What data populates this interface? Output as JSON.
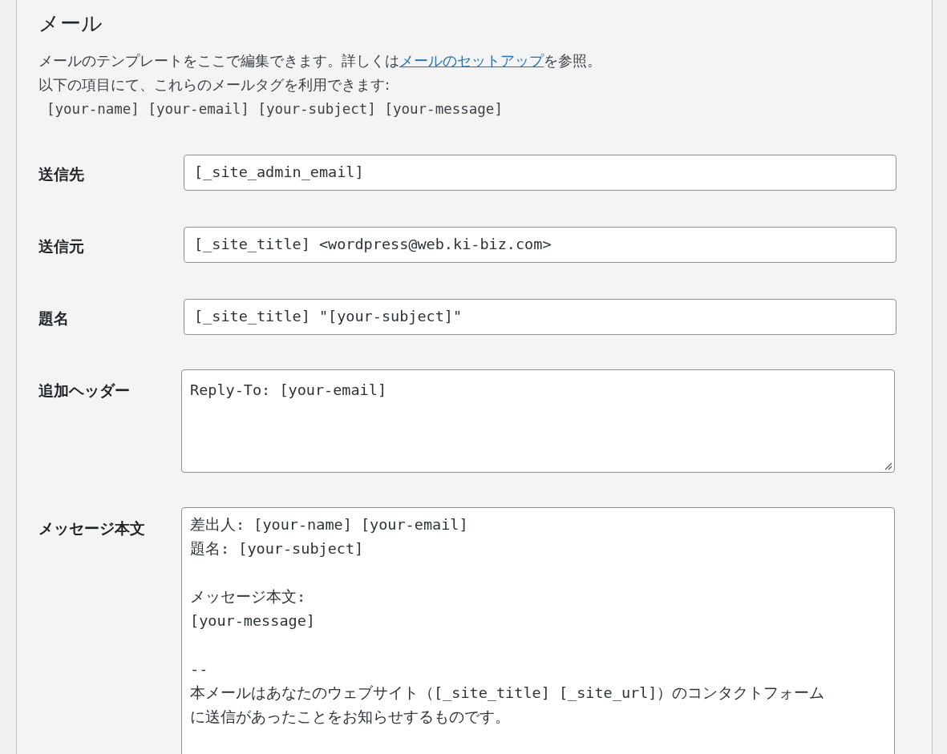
{
  "section": {
    "title": "メール",
    "description": {
      "before": "メールのテンプレートをここで編集できます。詳しくは",
      "link": "メールのセットアップ",
      "after": "を参照。"
    },
    "tags_intro": "以下の項目にて、これらのメールタグを利用できます:",
    "tags": "[your-name] [your-email] [your-subject] [your-message]"
  },
  "fields": [
    {
      "kind": "input",
      "label": "送信先",
      "value": "[_site_admin_email]"
    },
    {
      "kind": "input",
      "label": "送信元",
      "value": "[_site_title] <wordpress@web.ki-biz.com>"
    },
    {
      "kind": "input",
      "label": "題名",
      "value": "[_site_title] \"[your-subject]\""
    },
    {
      "kind": "textarea",
      "label": "追加ヘッダー",
      "value": "Reply-To: [your-email]"
    },
    {
      "kind": "body",
      "label": "メッセージ本文",
      "value": "差出人: [your-name] [your-email]\n題名: [your-subject]\n\nメッセージ本文:\n[your-message]\n\n--\n本メールはあなたのウェブサイト（[_site_title] [_site_url]）のコンタクトフォームに送信があったことをお知らせするものです。"
    }
  ]
}
